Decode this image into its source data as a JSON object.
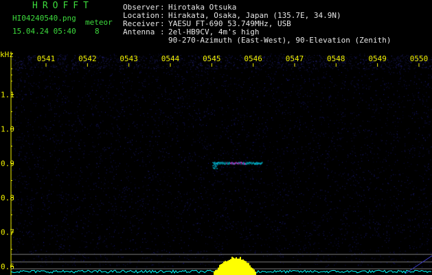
{
  "header": {
    "app_name": "HROFFT",
    "file_name": "HI04240540.png",
    "datetime": "15.04.24 05:40",
    "meteor_label": "meteor",
    "meteor_count": "8",
    "info": [
      {
        "key": "Observer",
        "sep": ":",
        "value": "Hirotaka Otsuka"
      },
      {
        "key": "Location",
        "sep": ":",
        "value": "Hirakata, Osaka, Japan (135.7E, 34.9N)"
      },
      {
        "key": "Receiver",
        "sep": ":",
        "value": "YAESU FT-690 53.749MHz, USB"
      },
      {
        "key": "Antenna",
        "sep": ":",
        "value": "2el-HB9CV, 4m's high"
      },
      {
        "key": "",
        "sep": "",
        "value": "90-270-Azimuth (East-West), 90-Elevation (Zenith)"
      }
    ]
  },
  "colors": {
    "background": "#000000",
    "noise": "#1a1a80",
    "axis_text": "#f2f200",
    "title_text": "#3ddc3d",
    "info_text": "#e8e8e8",
    "trace_yellow": "#ffff00",
    "baseline_cyan": "#00ffff",
    "meteor_cyan": "#00e0ff",
    "meteor_magenta": "#ff40ff"
  },
  "chart_data": {
    "type": "heatmap",
    "ylabel": "kHz",
    "x_ticks": [
      "0541",
      "0542",
      "0543",
      "0544",
      "0545",
      "0546",
      "0547",
      "0548",
      "0549",
      "0550"
    ],
    "y_ticks": [
      "1.1",
      "1.0",
      "0.9",
      "0.8",
      "0.7",
      "0.6"
    ],
    "ylim": [
      0.575,
      1.195
    ],
    "meteor_echo": {
      "time_start": "0545.05",
      "time_end": "0546.22",
      "frequency_khz": 0.9
    }
  }
}
